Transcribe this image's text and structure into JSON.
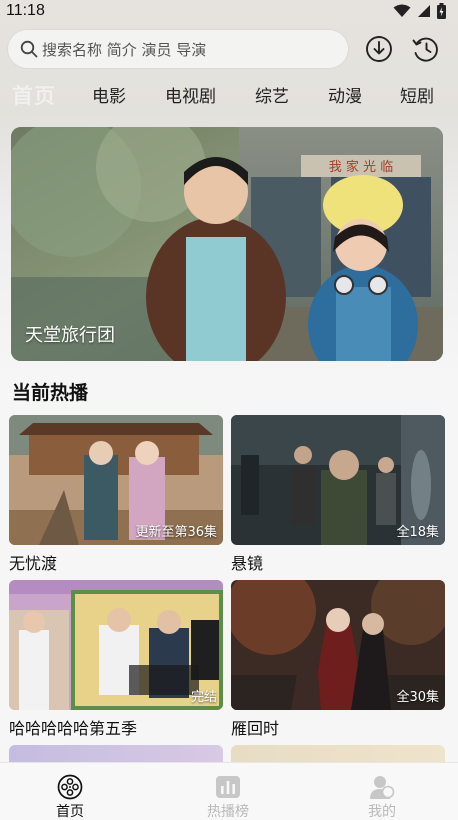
{
  "status_bar": {
    "time": "11:18"
  },
  "search": {
    "placeholder": "搜索名称 简介 演员 导演"
  },
  "header_icons": {
    "download": "download-icon",
    "history": "history-icon"
  },
  "nav_tabs": [
    {
      "label": "首页",
      "active": true
    },
    {
      "label": "电影",
      "active": false
    },
    {
      "label": "电视剧",
      "active": false
    },
    {
      "label": "综艺",
      "active": false
    },
    {
      "label": "动漫",
      "active": false
    },
    {
      "label": "短剧",
      "active": false
    }
  ],
  "banner": {
    "title": "天堂旅行团",
    "sign_text": "我 家 光 临"
  },
  "section": {
    "title": "当前热播"
  },
  "cards": [
    {
      "title": "无忧渡",
      "badge": "更新至第36集"
    },
    {
      "title": "悬镜",
      "badge": "全18集"
    },
    {
      "title": "哈哈哈哈哈第五季",
      "badge": "完结"
    },
    {
      "title": "雁回时",
      "badge": "全30集"
    }
  ],
  "bottom_nav": [
    {
      "label": "首页",
      "active": true,
      "icon": "film-reel-icon"
    },
    {
      "label": "热播榜",
      "active": false,
      "icon": "chart-icon"
    },
    {
      "label": "我的",
      "active": false,
      "icon": "profile-icon"
    }
  ],
  "colors": {
    "active_tab": "#f2f1ee",
    "inactive_bottom": "#b9b9b9",
    "active_bottom": "#111111"
  }
}
